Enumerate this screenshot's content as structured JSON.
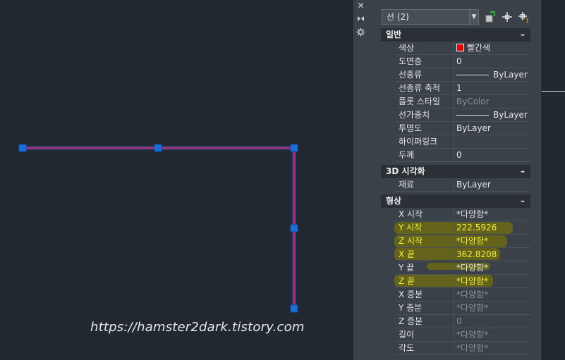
{
  "watermark": "https://hamster2dark.tistory.com",
  "palette_strip": {
    "icons": [
      "close-icon",
      "auto-hide-icon",
      "settings-icon"
    ]
  },
  "selector": {
    "value": "선 (2)",
    "icons": [
      "quick-select-icon",
      "select-objects-icon",
      "toggle-pickadd-icon"
    ]
  },
  "sections": {
    "general": {
      "title": "일반",
      "toggle": "–",
      "rows": [
        {
          "label": "색상",
          "value": "빨간색"
        },
        {
          "label": "도면층",
          "value": "0"
        },
        {
          "label": "선종류",
          "value": "ByLayer"
        },
        {
          "label": "선종류 축척",
          "value": "1"
        },
        {
          "label": "플롯 스타일",
          "value": "ByColor"
        },
        {
          "label": "선가중치",
          "value": "ByLayer"
        },
        {
          "label": "투명도",
          "value": "ByLayer"
        },
        {
          "label": "하이퍼링크",
          "value": ""
        },
        {
          "label": "두께",
          "value": "0"
        }
      ]
    },
    "visual3d": {
      "title": "3D 시각화",
      "toggle": "–",
      "rows": [
        {
          "label": "재료",
          "value": "ByLayer"
        }
      ]
    },
    "geometry": {
      "title": "형상",
      "toggle": "–",
      "rows": [
        {
          "label": "X 시작",
          "value": "*다양함*"
        },
        {
          "label": "Y 시작",
          "value": "222.5926"
        },
        {
          "label": "Z 시작",
          "value": "*다양함*"
        },
        {
          "label": "X 끝",
          "value": "362.8208"
        },
        {
          "label": "Y 끝",
          "value": "*다양함*"
        },
        {
          "label": "Z 끝",
          "value": "*다양함*"
        },
        {
          "label": "X 증분",
          "value": "*다양함*"
        },
        {
          "label": "Y 증분",
          "value": "*다양함*"
        },
        {
          "label": "Z 증분",
          "value": "0"
        },
        {
          "label": "길이",
          "value": "*다양함*"
        },
        {
          "label": "각도",
          "value": "*다양함*"
        }
      ]
    }
  },
  "colors": {
    "line": "#9b2f8c",
    "grip": "#1a6fd8",
    "highlight_text": "#f4f03a",
    "highlight_mark": "#6b6a15"
  }
}
